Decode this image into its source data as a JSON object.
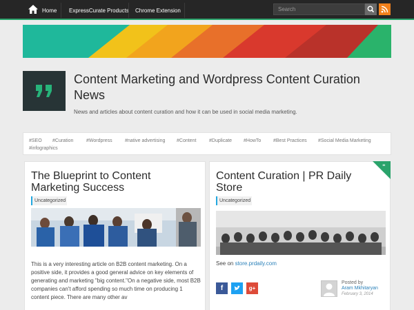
{
  "nav": {
    "home": "Home",
    "items": [
      "ExpressCurate Products",
      "Chrome Extension"
    ],
    "search_placeholder": "Search"
  },
  "site": {
    "title": "Content Marketing and Wordpress Content Curation News",
    "description": "News and articles about content curation and how it can be used in social media marketing."
  },
  "tags": [
    "#SEO",
    "#Curation",
    "#Wordpress",
    "#native advertising",
    "#Content",
    "#Duplicate",
    "#HowTo",
    "#Best Practices",
    "#Social Media Marketing",
    "#infographics"
  ],
  "posts": [
    {
      "title": "The Blueprint to Content Marketing Success",
      "category": "Uncategorized",
      "excerpt": "This is a very interesting article on B2B content marketing. On a positive side, it provides a good general advice on key elements of generating and marketing \"big content.\"On a negative side, most B2B companies can't afford spending so much time on producing 1 content piece. There are many other av"
    },
    {
      "title": "Content Curation | PR Daily Store",
      "category": "Uncategorized",
      "see_on_prefix": "See on ",
      "see_on_link": "store.prdaily.com",
      "posted_by": "Posted by",
      "author": "Aram Mkhitaryan",
      "date": "February 3, 2014"
    }
  ],
  "colors": {
    "accent_green": "#2aa36b",
    "category_bar": "#22a8e0",
    "rss": "#f2811c"
  }
}
